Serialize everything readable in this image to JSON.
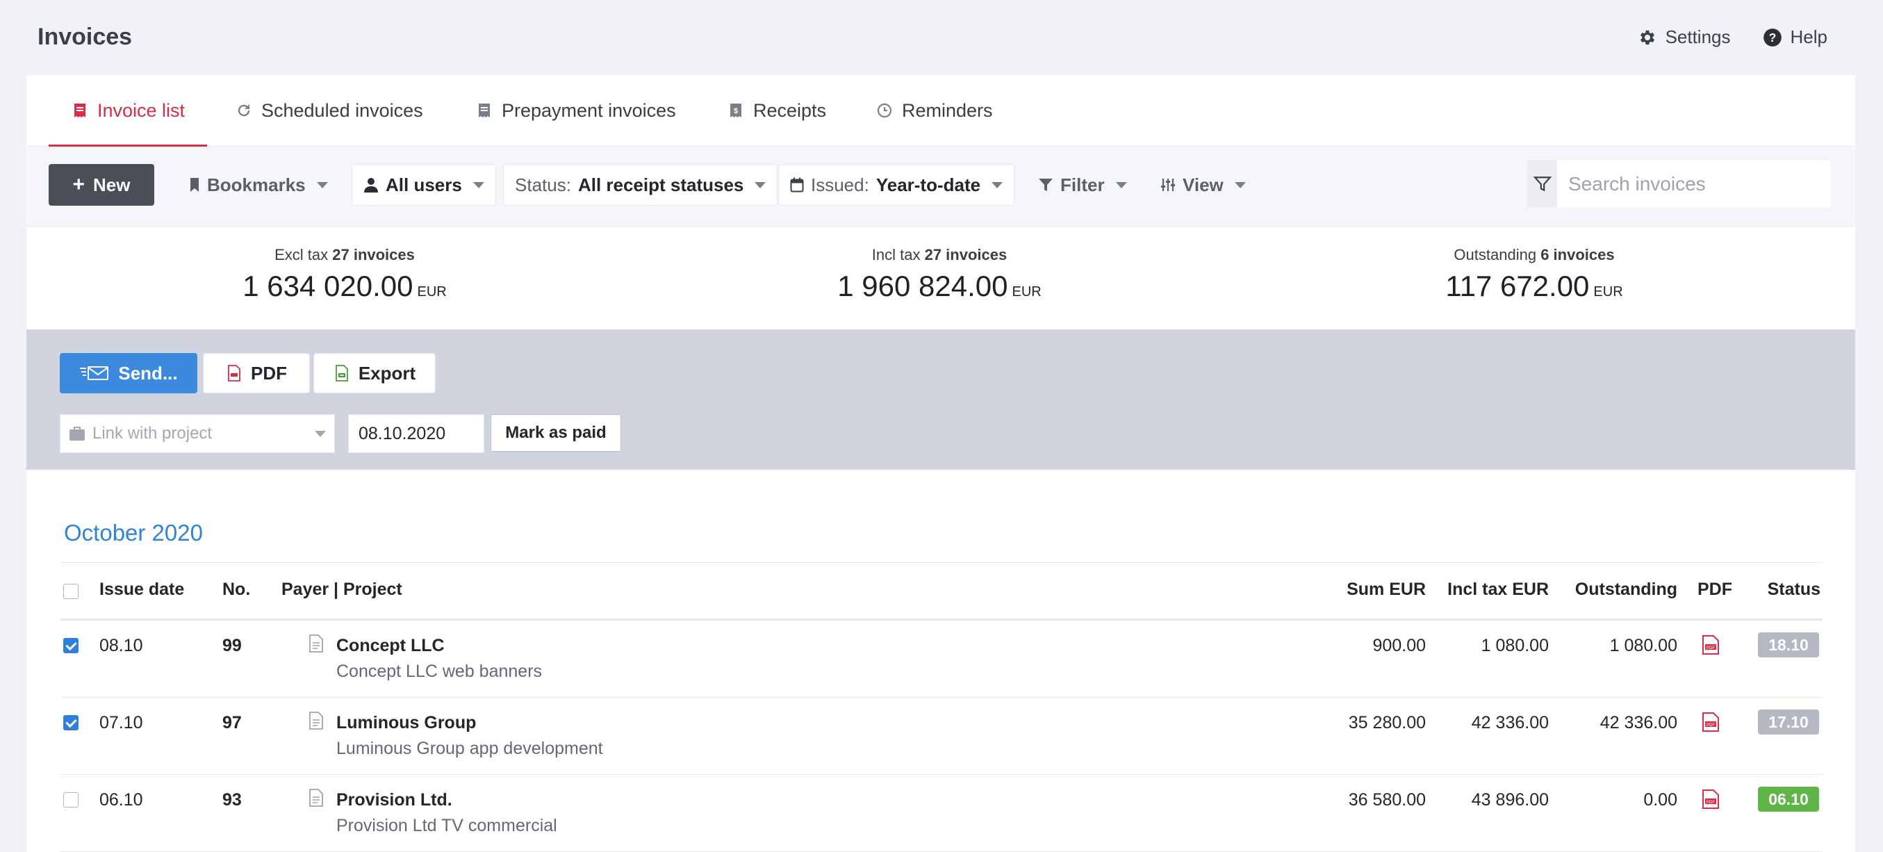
{
  "page": {
    "title": "Invoices"
  },
  "top_actions": {
    "settings": "Settings",
    "help": "Help"
  },
  "tabs": [
    {
      "label": "Invoice list",
      "active": true
    },
    {
      "label": "Scheduled invoices"
    },
    {
      "label": "Prepayment invoices"
    },
    {
      "label": "Receipts"
    },
    {
      "label": "Reminders"
    }
  ],
  "toolbar": {
    "new_label": "New",
    "bookmarks": "Bookmarks",
    "users": "All users",
    "status_label": "Status:",
    "status_value": "All receipt statuses",
    "issued_label": "Issued:",
    "issued_value": "Year-to-date",
    "filter": "Filter",
    "view": "View",
    "search_placeholder": "Search invoices"
  },
  "summary": [
    {
      "caption": "Excl tax",
      "count": "27 invoices",
      "value": "1 634 020.00",
      "currency": "EUR"
    },
    {
      "caption": "Incl tax",
      "count": "27 invoices",
      "value": "1 960 824.00",
      "currency": "EUR"
    },
    {
      "caption": "Outstanding",
      "count": "6 invoices",
      "value": "117 672.00",
      "currency": "EUR"
    }
  ],
  "actions": {
    "send": "Send...",
    "pdf": "PDF",
    "export": "Export",
    "project_placeholder": "Link with project",
    "date": "08.10.2020",
    "mark_paid": "Mark as paid"
  },
  "month": "October 2020",
  "table": {
    "headers": {
      "issue_date": "Issue date",
      "no": "No.",
      "payer": "Payer | Project",
      "sum": "Sum EUR",
      "incl": "Incl tax EUR",
      "outstanding": "Outstanding",
      "pdf": "PDF",
      "status": "Status"
    },
    "rows": [
      {
        "checked": true,
        "date": "08.10",
        "no": "99",
        "payer": "Concept LLC",
        "project": "Concept LLC web banners",
        "sum": "900.00",
        "incl": "1 080.00",
        "outstanding": "1 080.00",
        "status": "18.10",
        "status_color": "#b3b8c3"
      },
      {
        "checked": true,
        "date": "07.10",
        "no": "97",
        "payer": "Luminous Group",
        "project": "Luminous Group app development",
        "sum": "35 280.00",
        "incl": "42 336.00",
        "outstanding": "42 336.00",
        "status": "17.10",
        "status_color": "#b3b8c3"
      },
      {
        "checked": false,
        "date": "06.10",
        "no": "93",
        "payer": "Provision Ltd.",
        "project": "Provision Ltd TV commercial",
        "sum": "36 580.00",
        "incl": "43 896.00",
        "outstanding": "0.00",
        "status": "06.10",
        "status_color": "#5fb548"
      }
    ]
  },
  "colors": {
    "accent": "#d72d47",
    "primary": "#3b8ae0",
    "link": "#2f84d8"
  }
}
